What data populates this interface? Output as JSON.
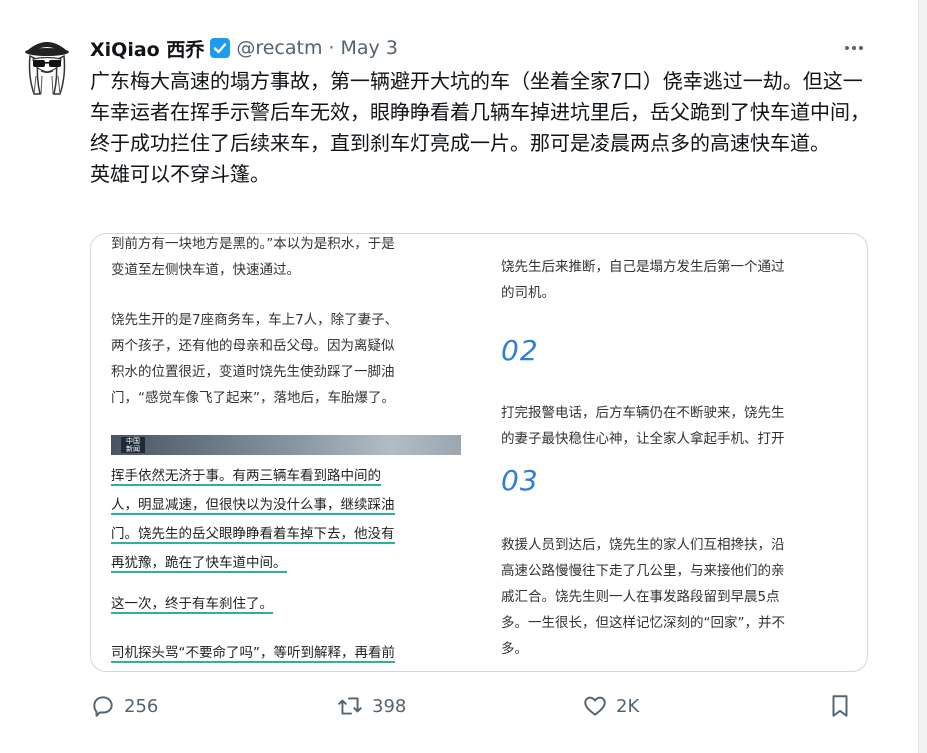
{
  "tweet": {
    "author_name": "XiQiao 西乔",
    "handle": "@recatm",
    "separator": "·",
    "date": "May 3",
    "text_lines": [
      "广东梅大高速的塌方事故，第一辆避开大坑的车（坐着全家7口）侥幸逃过一劫。但这一车幸运者在挥手示警后车无效，眼睁睁看着几辆车掉进坑里后，岳父跪到了快车道中间，终于成功拦住了后续来车，直到刹车灯亮成一片。那可是凌晨两点多的高速快车道。",
      "英雄可以不穿斗篷。"
    ]
  },
  "article": {
    "left": {
      "p1": "到前方有一块地方是黑的。”本以为是积水，于是\n变道至左侧快车道，快速通过。",
      "p2": "饶先生开的是7座商务车，车上7人，除了妻子、\n两个孩子，还有他的母亲和岳父母。因为离疑似\n积水的位置很近，变道时饶先生使劲踩了一脚油\n门，“感觉车像飞了起来”，落地后，车胎爆了。",
      "photo_logo": "中国\n新闻",
      "h1": [
        "挥手依然无济于事。有两三辆车看到路中间的",
        "人，明显减速，但很快以为没什么事，继续踩油",
        "门。饶先生的岳父眼睁睁看着车掉下去，他没有",
        "再犹豫，跪在了快车道中间。"
      ],
      "h2": "这一次，终于有车刹住了。",
      "h3": "司机探头骂“不要命了吗”，等听到解释，再看前"
    },
    "right": {
      "p1": "饶先生后来推断，自己是塌方发生后第一个通过\n的司机。",
      "num2": "02",
      "p2": "打完报警电话，后方车辆仍在不断驶来，饶先生\n的妻子最快稳住心神，让全家人拿起手机、打开",
      "num3": "03",
      "p3": "救援人员到达后，饶先生的家人们互相搀扶，沿\n高速公路慢慢往下走了几公里，与来接他们的亲\n戚汇合。饶先生则一人在事发路段留到早晨5点\n多。一生很长，但这样记忆深刻的“回家”，并不\n多。"
    }
  },
  "actions": {
    "reply_count": "256",
    "retweet_count": "398",
    "like_count": "2K"
  },
  "icons": {
    "avatar": "avatar-cartoon-sunglasses",
    "verified": "verified-badge-icon",
    "more": "more-dots-icon",
    "reply": "reply-icon",
    "retweet": "retweet-icon",
    "like": "heart-icon",
    "bookmark": "bookmark-icon"
  },
  "colors": {
    "verified_blue": "#1d9bf0",
    "secondary_text": "#536471",
    "highlight_underline": "#2bb39a",
    "section_number": "#2f7fd6"
  }
}
